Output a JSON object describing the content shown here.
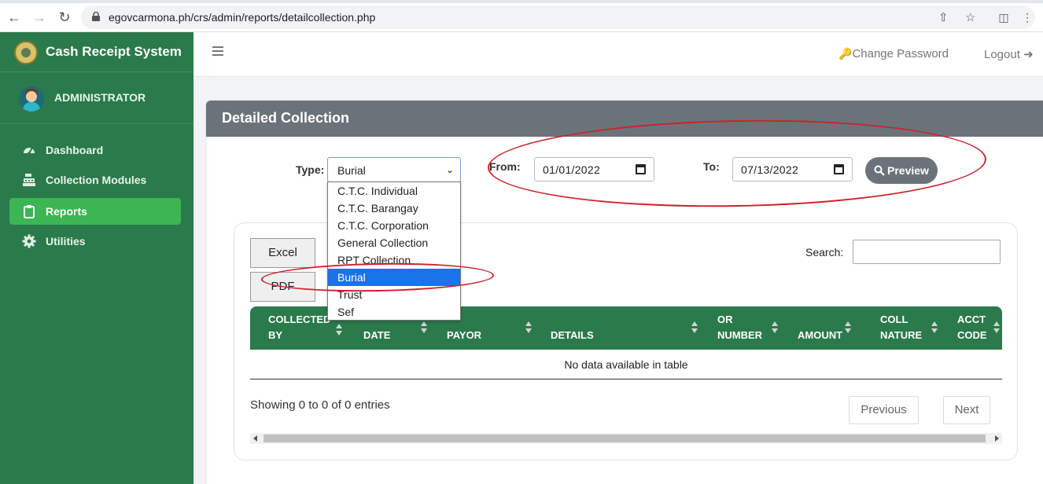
{
  "browser": {
    "url": "egovcarmona.ph/crs/admin/reports/detailcollection.php"
  },
  "sidebar": {
    "brand": "Cash Receipt System",
    "user": "ADMINISTRATOR",
    "items": [
      {
        "label": "Dashboard",
        "icon": "gauge-icon"
      },
      {
        "label": "Collection Modules",
        "icon": "cash-register-icon"
      },
      {
        "label": "Reports",
        "icon": "clipboard-icon",
        "active": true
      },
      {
        "label": "Utilities",
        "icon": "gear-icon"
      }
    ]
  },
  "topbar": {
    "change_password": "Change Password",
    "logout": "Logout"
  },
  "card": {
    "title": "Detailed Collection"
  },
  "filters": {
    "type_label": "Type:",
    "type_value": "Burial",
    "from_label": "From:",
    "from_value": "01/01/2022",
    "to_label": "To:",
    "to_value": "07/13/2022",
    "preview_label": "Preview",
    "type_options": [
      "C.T.C. Individual",
      "C.T.C. Barangay",
      "C.T.C. Corporation",
      "General Collection",
      "RPT Collection",
      "Burial",
      "Trust",
      "Sef"
    ]
  },
  "table": {
    "excel_label": "Excel",
    "pdf_label": "PDF",
    "search_label": "Search:",
    "columns": [
      [
        "COLLECTED",
        "BY"
      ],
      [
        "",
        "DATE"
      ],
      [
        "",
        "PAYOR"
      ],
      [
        "",
        "DETAILS"
      ],
      [
        "OR",
        "NUMBER"
      ],
      [
        "",
        "AMOUNT"
      ],
      [
        "COLL",
        "NATURE"
      ],
      [
        "ACCT",
        "CODE"
      ]
    ],
    "empty_message": "No data available in table",
    "info": "Showing 0 to 0 of 0 entries",
    "prev_label": "Previous",
    "next_label": "Next"
  },
  "colors": {
    "sidebar": "#2b7a4b",
    "active_item": "#3cb553",
    "header": "#6b737a",
    "annotation": "#d0202a"
  }
}
